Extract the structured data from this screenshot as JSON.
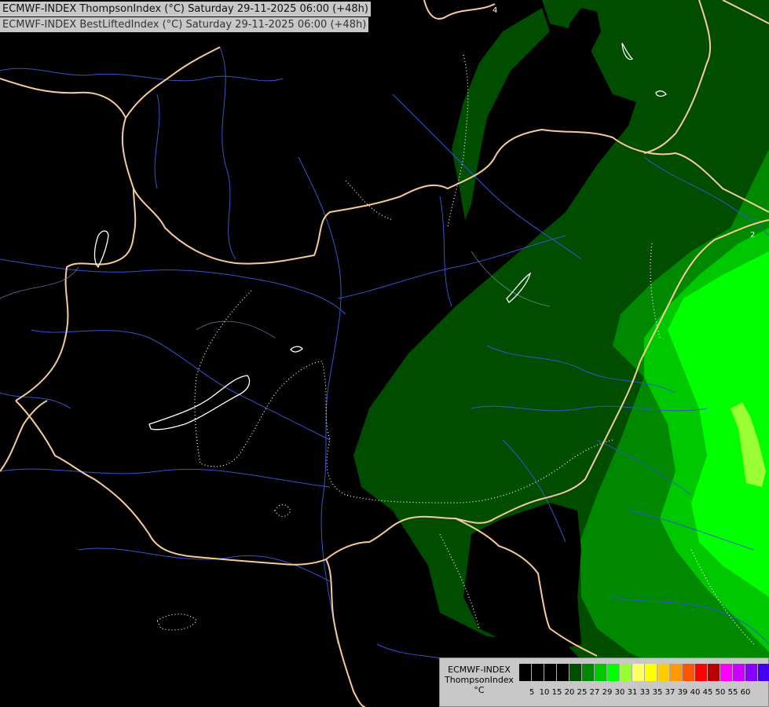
{
  "header": {
    "title_line1": "ECMWF-INDEX ThompsonIndex (°C) Saturday 29-11-2025 06:00 (+48h)",
    "title_line2": "ECMWF-INDEX BestLiftedIndex (°C) Saturday 29-11-2025 06:00 (+48h)"
  },
  "legend": {
    "model": "ECMWF-INDEX",
    "parameter": "ThompsonIndex",
    "unit": "°C",
    "colors": [
      "#000000",
      "#000000",
      "#000000",
      "#000000",
      "#004d00",
      "#008800",
      "#00c800",
      "#00ff00",
      "#99ff33",
      "#ffff66",
      "#ffff00",
      "#ffcc00",
      "#ff9900",
      "#ff5500",
      "#ff0000",
      "#bb0000",
      "#ff00ff",
      "#cc00ff",
      "#8800ff",
      "#4400ee",
      "#0000ff"
    ],
    "ticks": [
      "5",
      "10",
      "15",
      "20",
      "25",
      "27",
      "29",
      "30",
      "31",
      "33",
      "35",
      "37",
      "39",
      "40",
      "45",
      "50",
      "55",
      "60"
    ]
  },
  "contour_labels": [
    "4",
    "2"
  ],
  "colors": {
    "background": "#000000",
    "dark_green": "#004d00",
    "green": "#008800",
    "bright_green": "#00c800",
    "lime": "#00ff00",
    "yellow_green": "#99ff33",
    "borders": "#f5cc99",
    "rivers": "#3355cc",
    "contours": "#ffffff"
  }
}
